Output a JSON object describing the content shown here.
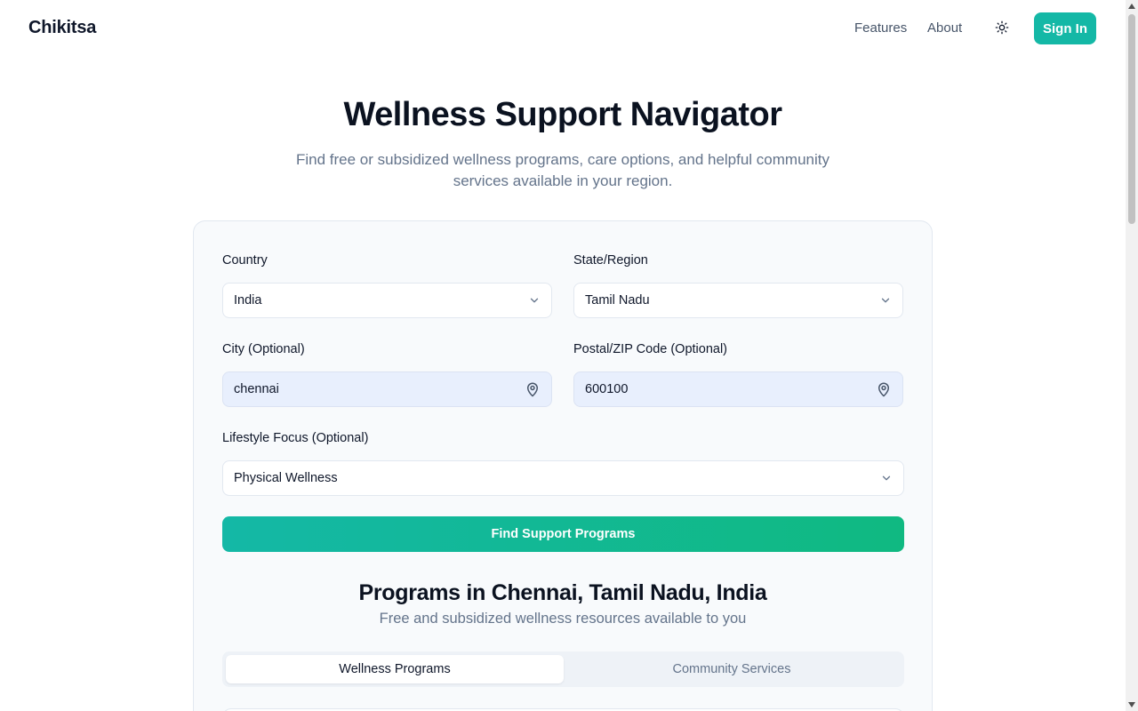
{
  "header": {
    "brand": "Chikitsa",
    "nav": {
      "features": "Features",
      "about": "About"
    },
    "sign_in": "Sign In",
    "theme_icon": "sun-icon"
  },
  "hero": {
    "title": "Wellness Support Navigator",
    "subtitle": "Find free or subsidized wellness programs, care options, and helpful community services available in your region."
  },
  "form": {
    "country": {
      "label": "Country",
      "value": "India"
    },
    "state": {
      "label": "State/Region",
      "value": "Tamil Nadu"
    },
    "city": {
      "label": "City (Optional)",
      "value": "chennai"
    },
    "postal": {
      "label": "Postal/ZIP Code (Optional)",
      "value": "600100"
    },
    "lifestyle": {
      "label": "Lifestyle Focus (Optional)",
      "value": "Physical Wellness"
    },
    "submit": "Find Support Programs"
  },
  "results": {
    "title": "Programs in Chennai, Tamil Nadu, India",
    "subtitle": "Free and subsidized wellness resources available to you",
    "tabs": [
      {
        "label": "Wellness Programs",
        "active": true
      },
      {
        "label": "Community Services",
        "active": false
      }
    ]
  },
  "colors": {
    "accent": "#14b8a6",
    "accent_end": "#10b981",
    "input_fill": "#e8effd"
  }
}
